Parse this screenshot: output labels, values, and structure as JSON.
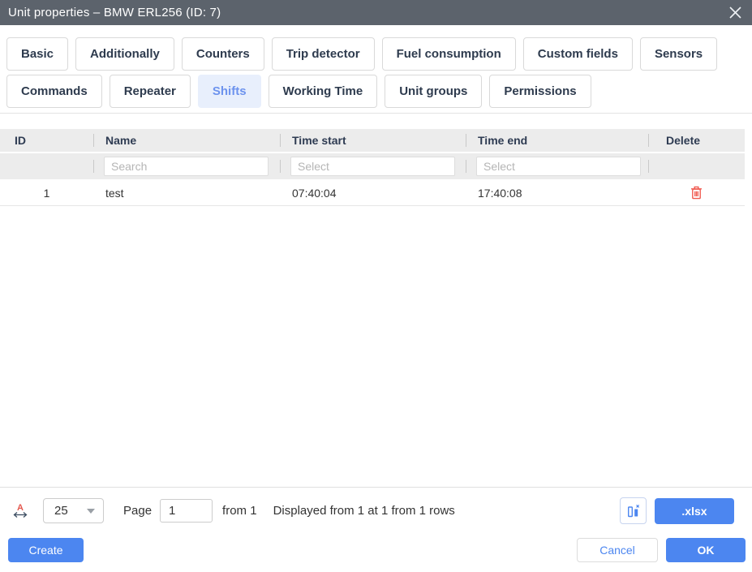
{
  "dialog": {
    "title": "Unit properties – BMW ERL256 (ID: 7)"
  },
  "tabs": {
    "items": [
      {
        "label": "Basic",
        "selected": false
      },
      {
        "label": "Additionally",
        "selected": false
      },
      {
        "label": "Counters",
        "selected": false
      },
      {
        "label": "Trip detector",
        "selected": false
      },
      {
        "label": "Fuel consumption",
        "selected": false
      },
      {
        "label": "Custom fields",
        "selected": false
      },
      {
        "label": "Sensors",
        "selected": false
      },
      {
        "label": "Commands",
        "selected": false
      },
      {
        "label": "Repeater",
        "selected": false
      },
      {
        "label": "Shifts",
        "selected": true
      },
      {
        "label": "Working Time",
        "selected": false
      },
      {
        "label": "Unit groups",
        "selected": false
      },
      {
        "label": "Permissions",
        "selected": false
      }
    ]
  },
  "table": {
    "columns": [
      "ID",
      "Name",
      "Time start",
      "Time end",
      "Delete"
    ],
    "filters": {
      "name_placeholder": "Search",
      "time_start_placeholder": "Select",
      "time_end_placeholder": "Select"
    },
    "rows": [
      {
        "id": "1",
        "name": "test",
        "time_start": "07:40:04",
        "time_end": "17:40:08"
      }
    ]
  },
  "pagination": {
    "page_size": "25",
    "page_label": "Page",
    "page_value": "1",
    "total_pages_text": "from 1",
    "displayed_text": "Displayed from 1 at 1 from 1 rows",
    "export_label": ".xlsx"
  },
  "actions": {
    "create": "Create",
    "cancel": "Cancel",
    "ok": "OK"
  },
  "icons": {
    "close": "x-cross",
    "dropdown_caret": "chevron-down-triangle",
    "delete": "trash-can",
    "toggle_columns": "two-columns-with-x",
    "fit_columns": "red-A-over-double-arrow"
  },
  "colors": {
    "titlebar": "#5c636c",
    "accent_blue": "#4c86f0",
    "selected_tab_bg": "#e8effc",
    "selected_tab_text": "#6d93ee",
    "header_bg": "#ececec",
    "delete_icon_red": "#f0594f",
    "fit_icon_red": "#e4574d",
    "fit_arrow_navy": "#3e4f63"
  }
}
